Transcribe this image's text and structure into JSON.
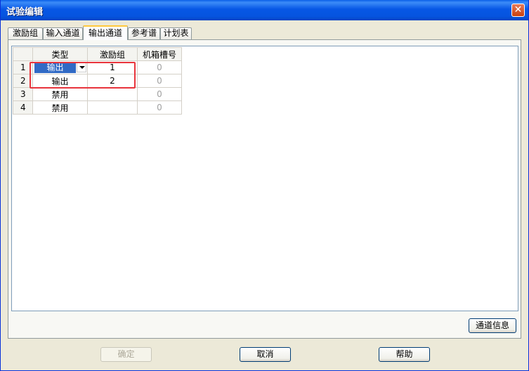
{
  "window": {
    "title": "试验编辑",
    "close_label": "✕"
  },
  "tabs": [
    {
      "label": "激励组"
    },
    {
      "label": "输入通道"
    },
    {
      "label": "输出通道"
    },
    {
      "label": "参考谱"
    },
    {
      "label": "计划表"
    }
  ],
  "grid": {
    "columns": [
      "",
      "类型",
      "激励组",
      "机箱槽号"
    ],
    "rows": [
      {
        "num": "1",
        "type": "输出",
        "group": "1",
        "slot": "0"
      },
      {
        "num": "2",
        "type": "输出",
        "group": "2",
        "slot": "0"
      },
      {
        "num": "3",
        "type": "禁用",
        "group": "",
        "slot": "0"
      },
      {
        "num": "4",
        "type": "禁用",
        "group": "",
        "slot": "0"
      }
    ]
  },
  "buttons": {
    "channel_info": "通道信息",
    "ok": "确定",
    "cancel": "取消",
    "help": "帮助"
  }
}
